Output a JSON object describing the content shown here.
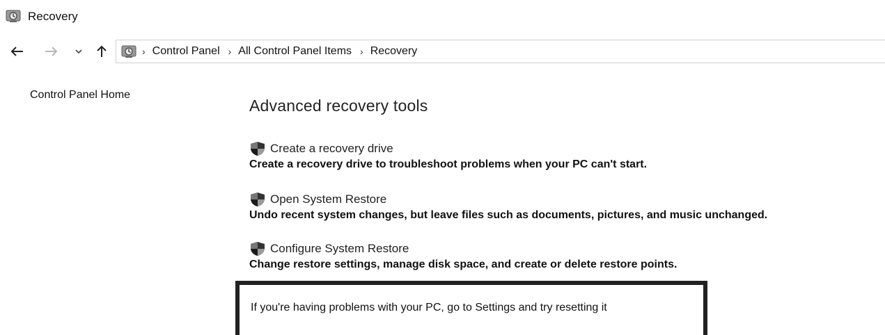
{
  "window": {
    "title": "Recovery",
    "icon": "recovery-icon"
  },
  "nav": {
    "back_icon": "back-arrow-icon",
    "forward_icon": "forward-arrow-icon",
    "recent_icon": "chevron-down-icon",
    "up_icon": "up-arrow-icon"
  },
  "address": {
    "location_icon": "recovery-icon",
    "breadcrumbs": [
      "Control Panel",
      "All Control Panel Items",
      "Recovery"
    ]
  },
  "sidebar": {
    "home_link": "Control Panel Home"
  },
  "main": {
    "heading": "Advanced recovery tools",
    "tools": [
      {
        "label": "Create a recovery drive",
        "icon": "shield-icon",
        "description": "Create a recovery drive to troubleshoot problems when your PC can't start."
      },
      {
        "label": "Open System Restore",
        "icon": "shield-icon",
        "description": "Undo recent system changes, but leave files such as documents, pictures, and music unchanged."
      },
      {
        "label": "Configure System Restore",
        "icon": "shield-icon",
        "description": "Change restore settings, manage disk space, and create or delete restore points."
      }
    ],
    "reset_message": "If you're having problems with your PC, go to Settings and try resetting it"
  }
}
